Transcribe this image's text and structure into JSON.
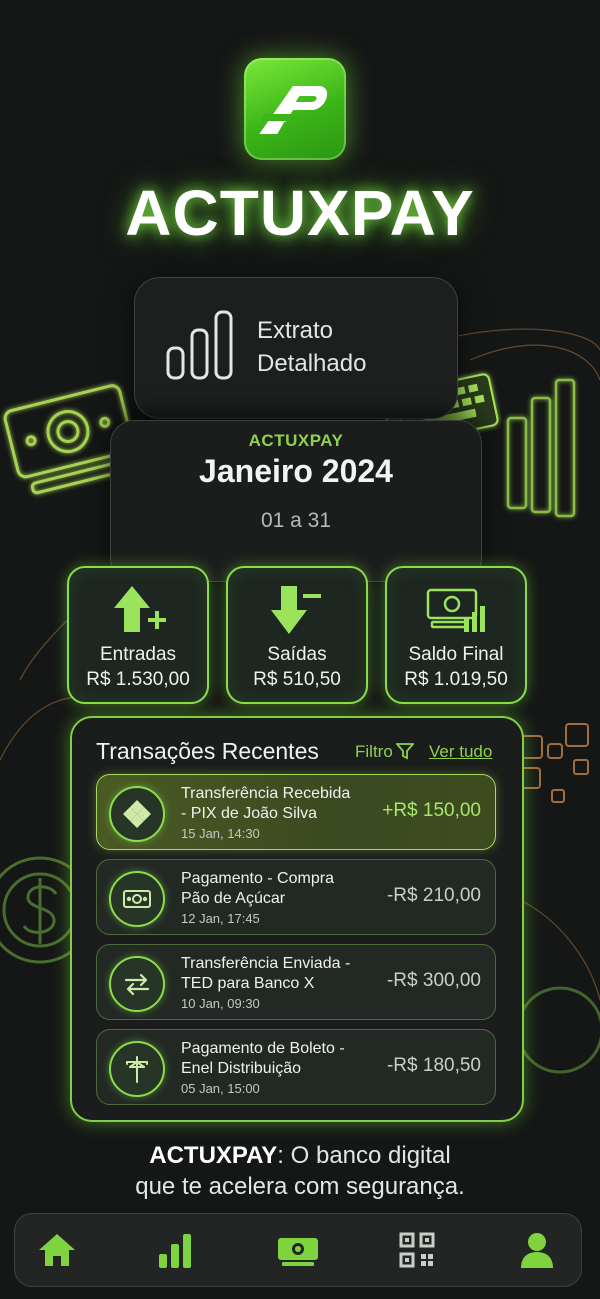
{
  "app": {
    "title": "ACTUXPAY",
    "logo_letters": "AP"
  },
  "statement": {
    "title_line1": "Extrato",
    "title_line2": "Detalhado"
  },
  "period": {
    "brand": "ACTUXPAY",
    "month": "Janeiro 2024",
    "range": "01 a 31"
  },
  "summary": [
    {
      "label": "Entradas",
      "value": "R$ 1.530,00",
      "icon": "arrow-up-plus-icon"
    },
    {
      "label": "Saídas",
      "value": "R$ 510,50",
      "icon": "arrow-down-minus-icon"
    },
    {
      "label": "Saldo Final",
      "value": "R$ 1.019,50",
      "icon": "money-chart-icon"
    }
  ],
  "transactions": {
    "title": "Transações Recentes",
    "filter_label": "Filtro",
    "see_all_label": "Ver tudo",
    "items": [
      {
        "line1": "Transferência Recebida",
        "line2": "- PIX de João Silva",
        "date": "15 Jan, 14:30",
        "amount": "+R$ 150,00",
        "icon": "pix-icon",
        "highlighted": true
      },
      {
        "line1": "Pagamento - Compra",
        "line2": "Pão de Açúcar",
        "date": "12 Jan, 17:45",
        "amount": "-R$ 210,00",
        "icon": "banknote-icon",
        "highlighted": false
      },
      {
        "line1": "Transferência Enviada -",
        "line2": "TED para Banco X",
        "date": "10 Jan, 09:30",
        "amount": "-R$ 300,00",
        "icon": "transfer-arrows-icon",
        "highlighted": false
      },
      {
        "line1": "Pagamento de Boleto -",
        "line2": "Enel Distribuição",
        "date": "05 Jan, 15:00",
        "amount": "-R$ 180,50",
        "icon": "utility-pole-icon",
        "highlighted": false
      }
    ]
  },
  "tagline": {
    "brand": "ACTUXPAY",
    "rest_line1": ": O banco digital",
    "line2": "que te acelera com segurança."
  },
  "nav": [
    "home-icon",
    "chart-icon",
    "money-icon",
    "qr-code-icon",
    "profile-icon"
  ],
  "colors": {
    "accent": "#8bdc4c",
    "background": "#151716",
    "card": "#1b1d1c"
  }
}
